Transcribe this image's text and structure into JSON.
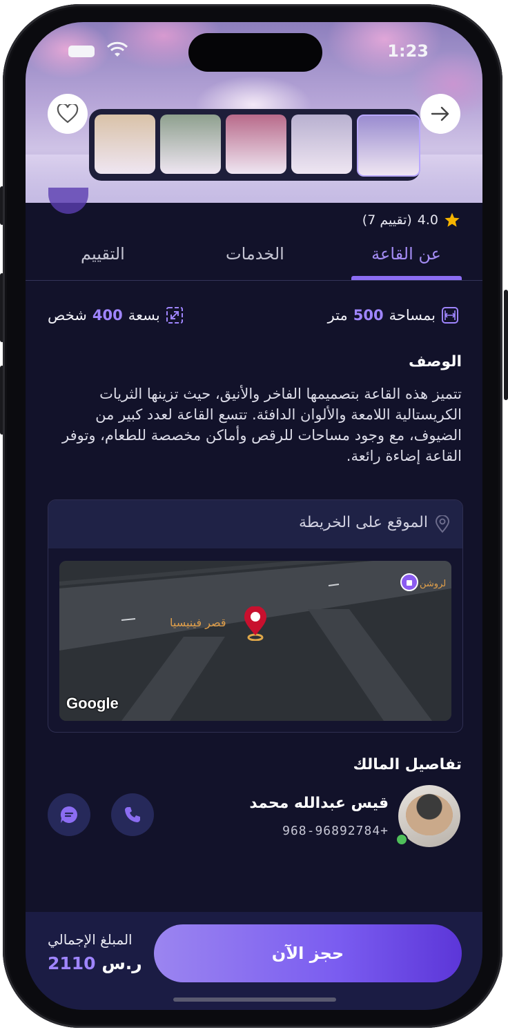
{
  "status_bar": {
    "time": "1:23"
  },
  "gallery": {
    "thumbnail_count": 5,
    "thumbnail_colors": [
      "#d9c2a8",
      "#8ea08e",
      "#b86a8a",
      "#b8b0d0",
      "#9a8cd0"
    ]
  },
  "hall": {
    "rating_value": "4.0",
    "rating_count": "(7 تقييم)",
    "area_label": "بمساحة",
    "area_value": "500",
    "area_unit": "متر",
    "capacity_label": "بسعة",
    "capacity_value": "400",
    "capacity_unit": "شخص"
  },
  "tabs": [
    {
      "label": "عن القاعة",
      "active": true
    },
    {
      "label": "الخدمات",
      "active": false
    },
    {
      "label": "التقييم",
      "active": false
    }
  ],
  "description": {
    "title": "الوصف",
    "text": "تتميز هذه القاعة بتصميمها الفاخر والأنيق، حيث تزينها الثريات الكريستالية اللامعة والألوان الدافئة. تتسع القاعة لعدد كبير من الضيوف، مع وجود مساحات للرقص وأماكن مخصصة للطعام، وتوفر القاعة إضاءة رائعة."
  },
  "map": {
    "title": "الموقع على الخريطة",
    "venue_label": "قصر فينيسيا",
    "poi_label": "لروشن",
    "attribution": "Google"
  },
  "owner": {
    "section_title": "تفاصيل المالك",
    "name": "قيس عبدالله محمد",
    "phone": "968-96892784+"
  },
  "footer": {
    "book_label": "حجز الآن",
    "total_label": "المبلغ الإجمالي",
    "total_amount": "2110",
    "currency": "ر.س"
  },
  "colors": {
    "accent": "#8b6df2",
    "background": "#12122a",
    "footer": "#1b1c44",
    "star": "#f6b400"
  }
}
